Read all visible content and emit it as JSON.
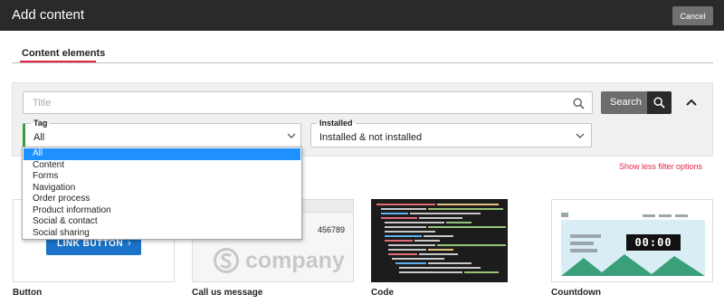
{
  "header": {
    "title": "Add content",
    "cancel_label": "Cancel"
  },
  "tabs": [
    {
      "label": "Content elements",
      "active": true
    }
  ],
  "search": {
    "placeholder": "Title",
    "value": "",
    "button_label": "Search"
  },
  "filters": {
    "tag": {
      "label": "Tag",
      "value": "All"
    },
    "installed": {
      "label": "Installed",
      "value": "Installed & not installed"
    },
    "toggle_label": "Show less filter options"
  },
  "tag_dropdown": {
    "options": [
      "All",
      "Content",
      "Forms",
      "Navigation",
      "Order process",
      "Product information",
      "Social & contact",
      "Social sharing"
    ],
    "selected_index": 0
  },
  "cards": [
    {
      "label": "Button",
      "preview_text": "LINK BUTTON"
    },
    {
      "label": "Call us message",
      "preview_phone": "456789",
      "preview_brand": "company"
    },
    {
      "label": "Code"
    },
    {
      "label": "Countdown",
      "preview_digits": "00:00"
    }
  ],
  "colors": {
    "accent": "#e02645",
    "topbar": "#2a2a2a",
    "selected": "#1e90ff",
    "link_button": "#1a73c9",
    "tag_indicator": "#3a9c3a"
  }
}
